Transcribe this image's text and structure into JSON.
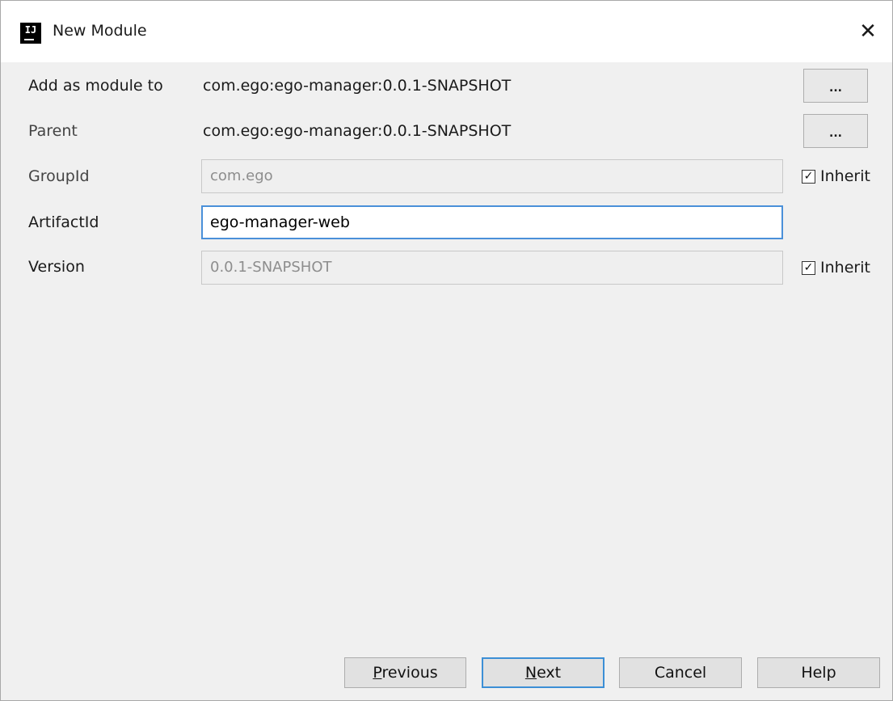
{
  "window": {
    "title": "New Module",
    "app_icon_text": "IJ",
    "close_glyph": "✕"
  },
  "form": {
    "add_as_module_to": {
      "label": "Add as module to",
      "value": "com.ego:ego-manager:0.0.1-SNAPSHOT",
      "browse_label": "..."
    },
    "parent": {
      "label": "Parent",
      "value": "com.ego:ego-manager:0.0.1-SNAPSHOT",
      "browse_label": "..."
    },
    "group_id": {
      "label": "GroupId",
      "value": "com.ego",
      "inherit_label": "Inherit",
      "inherit_checked": true
    },
    "artifact_id": {
      "label": "ArtifactId",
      "value": "ego-manager-web"
    },
    "version": {
      "label": "Version",
      "value": "0.0.1-SNAPSHOT",
      "inherit_label": "Inherit",
      "inherit_checked": true
    }
  },
  "buttons": {
    "previous": {
      "mnemonic": "P",
      "rest": "revious"
    },
    "next": {
      "mnemonic": "N",
      "rest": "ext"
    },
    "cancel": "Cancel",
    "help": "Help"
  },
  "colors": {
    "dialog_bg": "#f0f0f0",
    "focus_border": "#4a90d9",
    "disabled_text": "#8d8d8d"
  },
  "icons": {
    "app": "intellij-idea-icon",
    "close": "close-icon",
    "checkbox": "checkmark-icon"
  }
}
